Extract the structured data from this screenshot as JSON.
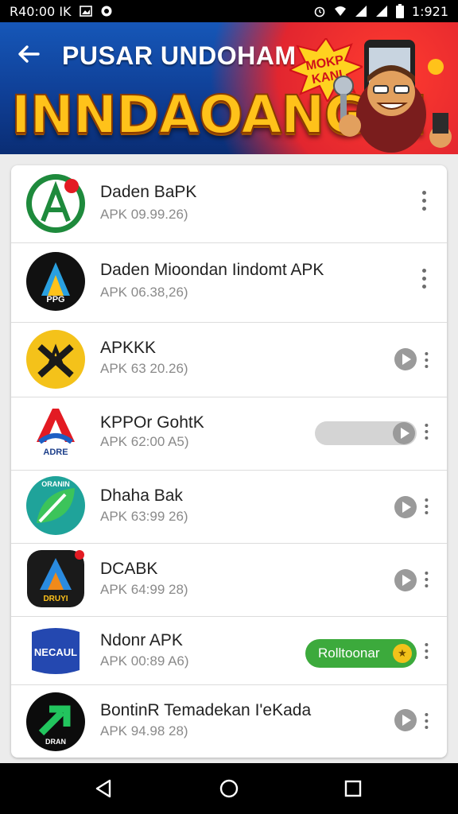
{
  "status_bar": {
    "time_left": "R40:00 IK",
    "clock": "1:921"
  },
  "header": {
    "title": "PUSAR UNDOHAM",
    "promo_text": "INNDAOANGA!",
    "burst_line1": "MOKP",
    "burst_line2": "KANI"
  },
  "apps": [
    {
      "name": "Daden BaPK",
      "version": "APK 09.99.26)",
      "icon_text": "",
      "action": "menu"
    },
    {
      "name": "Daden Mioondan Iindomt APK",
      "version": "APK 06.38,26)",
      "icon_text": "PPG",
      "action": "menu"
    },
    {
      "name": "APKKK",
      "version": "APK 63 20.26)",
      "icon_text": "",
      "action": "play"
    },
    {
      "name": "KPPOr GohtK",
      "version": "APK 62:00 A5)",
      "icon_text": "ADRE",
      "action": "slider"
    },
    {
      "name": "Dhaha Bak",
      "version": "APK 63:99 26)",
      "icon_text": "ORANIN",
      "action": "play"
    },
    {
      "name": "DCABK",
      "version": "APK 64:99 28)",
      "icon_text": "DRUYI",
      "action": "play"
    },
    {
      "name": "Ndonr APK",
      "version": "APK 00:89 A6)",
      "icon_text": "NECAUL",
      "action": "button",
      "button_label": "Rolltoonar"
    },
    {
      "name": "BontinR Temadekan I'eKada",
      "version": "APK 94.98 28)",
      "icon_text": "DRAN",
      "action": "play"
    }
  ],
  "colors": {
    "banner_blue": "#0f3f96",
    "accent_gold": "#ffc21a",
    "install_green": "#3caa3c"
  }
}
